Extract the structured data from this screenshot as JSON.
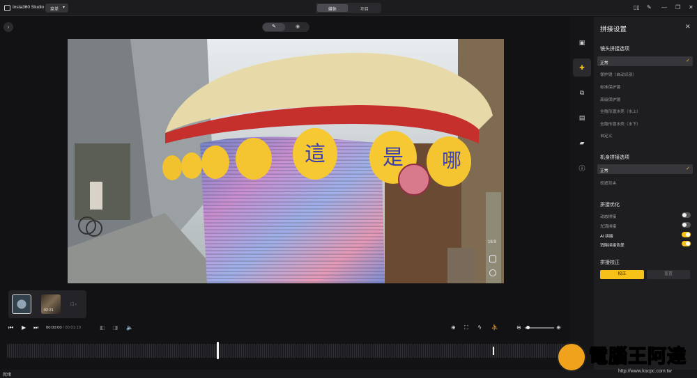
{
  "titlebar": {
    "app_title": "Insta360 Studio",
    "menu_label": "菜单",
    "tabs": [
      {
        "label": "媒体",
        "active": true
      },
      {
        "label": "项目",
        "active": false
      }
    ]
  },
  "viewer": {
    "mode_icons": [
      "edit-icon",
      "eye-icon"
    ],
    "aspect_ratio": "16:9",
    "photo_lantern_chars": [
      "這",
      "是",
      "哪"
    ]
  },
  "rail": {
    "items": [
      "camera-icon",
      "stitch-puzzle-icon",
      "export-icon",
      "metadata-icon",
      "storage-icon",
      "info-icon"
    ],
    "active_index": 1
  },
  "panel": {
    "title": "拼接设置",
    "lens_section": {
      "title": "镜头拼接选项",
      "options": [
        {
          "label": "正常",
          "selected": true
        },
        {
          "label": "保护镜（自动识别）",
          "selected": false
        },
        {
          "label": "标准保护镜",
          "selected": false
        },
        {
          "label": "高级保护镜",
          "selected": false
        },
        {
          "label": "全隐形潜水壳（水上）",
          "selected": false
        },
        {
          "label": "全隐形潜水壳（水下）",
          "selected": false
        },
        {
          "label": "自定义",
          "selected": false
        }
      ]
    },
    "body_section": {
      "title": "机身拼接选项",
      "options": [
        {
          "label": "正常",
          "selected": true
        },
        {
          "label": "挖遮背夹",
          "selected": false
        }
      ]
    },
    "optimize_section": {
      "title": "拼接优化",
      "toggles": [
        {
          "label": "动态拼接",
          "on": false
        },
        {
          "label": "光流拼接",
          "on": false
        },
        {
          "label": "AI 拼接",
          "on": true
        },
        {
          "label": "消除拼接色差",
          "on": true
        }
      ]
    },
    "calibration_section": {
      "title": "拼接校正",
      "calibrate_label": "校正",
      "reset_label": "重置"
    }
  },
  "clips": {
    "second_duration": "02:21"
  },
  "transport": {
    "current_time": "00:00:00",
    "total_time": "/ 00:01:10"
  },
  "statusbar": {
    "text": "就绪"
  },
  "watermark": {
    "text": "電腦王阿達",
    "url": "http://www.kocpc.com.tw"
  },
  "colors": {
    "accent": "#f6c21a",
    "background": "#121214",
    "panel": "#1e1e21"
  }
}
